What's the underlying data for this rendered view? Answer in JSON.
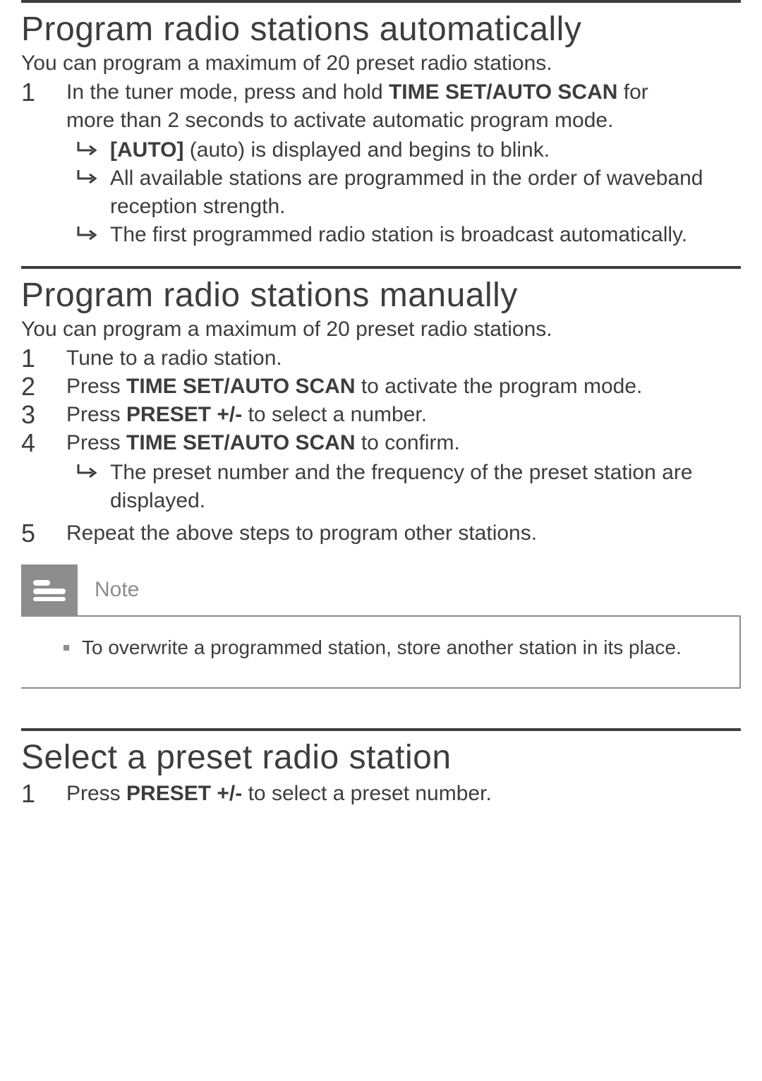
{
  "section1": {
    "title": "Program radio stations automatically",
    "intro": "You can program a maximum of 20 preset radio stations.",
    "step1_prefix": "In the tuner mode, press and hold ",
    "step1_bold": "TIME SET/AUTO SCAN",
    "step1_mid": " for",
    "step1_suffix": "more than 2 seconds to activate automatic program mode.",
    "result1_prefix": "[AUTO]",
    "result1_suffix": " (auto) is displayed and begins to blink.",
    "result2": "All available stations are programmed in the order of waveband reception strength.",
    "result3": "The ﬁrst programmed radio station is broadcast automatically."
  },
  "section2": {
    "title": "Program radio stations manually",
    "intro": "You can program a maximum of 20 preset radio stations.",
    "step1": "Tune to a radio station.",
    "step2_prefix": "Press ",
    "step2_bold": "TIME SET/AUTO SCAN",
    "step2_suffix": " to activate the program mode.",
    "step3_prefix": "Press ",
    "step3_bold": "PRESET +/-",
    "step3_suffix": " to select a number.",
    "step4_prefix": "Press ",
    "step4_bold": "TIME SET/AUTO SCAN",
    "step4_suffix": " to conﬁrm.",
    "step4_result": "The preset number and the frequency of the preset station are displayed.",
    "step5": "Repeat the above steps to program other stations.",
    "note_label": "Note",
    "note_body": "To overwrite a programmed station, store another station in its place."
  },
  "section3": {
    "title": "Select a preset radio station",
    "step1_prefix": "Press ",
    "step1_bold": "PRESET +/-",
    "step1_suffix": " to select a preset number."
  }
}
